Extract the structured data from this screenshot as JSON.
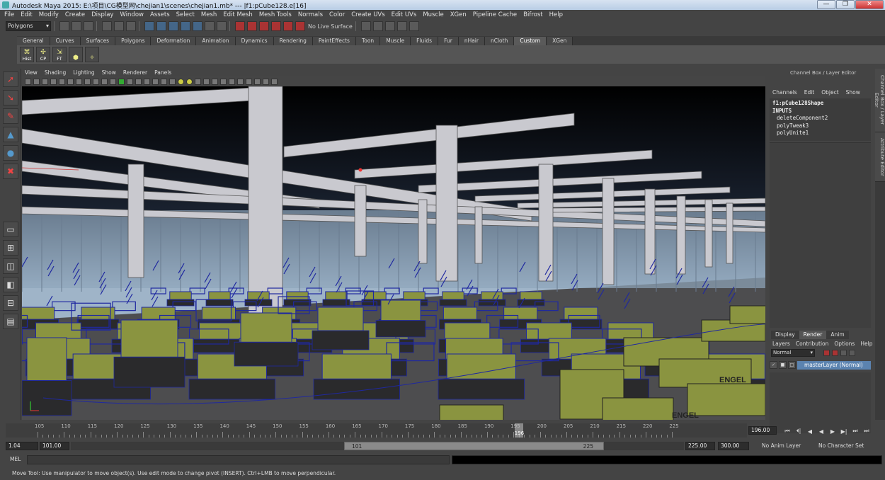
{
  "window": {
    "title": "Autodesk Maya 2015: E:\\项目\\CG模型网\\chejian1\\scenes\\chejian1.mb*   ---   |f1:pCube128.e[16]",
    "min": "—",
    "max": "❐",
    "close": "✕"
  },
  "menu": [
    "File",
    "Edit",
    "Modify",
    "Create",
    "Display",
    "Window",
    "Assets",
    "Select",
    "Mesh",
    "Edit Mesh",
    "Mesh Tools",
    "Normals",
    "Color",
    "Create UVs",
    "Edit UVs",
    "Muscle",
    "XGen",
    "Pipeline Cache",
    "Bifrost",
    "Help"
  ],
  "status_line": {
    "mode": "Polygons",
    "live_surface": "No Live Surface"
  },
  "shelf": {
    "tabs": [
      "General",
      "Curves",
      "Surfaces",
      "Polygons",
      "Deformation",
      "Animation",
      "Dynamics",
      "Rendering",
      "PaintEffects",
      "Toon",
      "Muscle",
      "Fluids",
      "Fur",
      "nHair",
      "nCloth",
      "Custom",
      "XGen"
    ],
    "active_tab": "Custom",
    "buttons": [
      {
        "label": "Hist",
        "icon": "history-icon"
      },
      {
        "label": "CP",
        "icon": "center-pivot-icon"
      },
      {
        "label": "FT",
        "icon": "freeze-transform-icon"
      },
      {
        "label": "",
        "icon": "custom-tool-icon"
      },
      {
        "label": "",
        "icon": "custom-tool-2-icon"
      }
    ]
  },
  "viewport": {
    "menu": [
      "View",
      "Shading",
      "Lighting",
      "Show",
      "Renderer",
      "Panels"
    ],
    "colors": {
      "sky_top": "#000000",
      "sky_horizon": "#9fb4c8",
      "floor": "#4d4d4f",
      "beam": "#c9c9cf",
      "machine": "#8a9440",
      "wire": "#1f28a0"
    },
    "labels": [
      "ENGEL",
      "ENGEL"
    ]
  },
  "channel_box": {
    "header": "Channel Box / Layer Editor",
    "menu": [
      "Channels",
      "Edit",
      "Object",
      "Show"
    ],
    "shape": "f1:pCube128Shape",
    "inputs_label": "INPUTS",
    "inputs": [
      "deleteComponent2",
      "polyTweak3",
      "polyUnite1"
    ]
  },
  "layer_editor": {
    "tabs": [
      "Display",
      "Render",
      "Anim"
    ],
    "active_tab": "Render",
    "menu": [
      "Layers",
      "Contribution",
      "Options",
      "Help"
    ],
    "blend_mode": "Normal",
    "layer_name": "masterLayer (Normal)"
  },
  "side_tabs": [
    "Channel Box / Layer Editor",
    "Attribute Editor"
  ],
  "timeline": {
    "ticks": [
      "105",
      "110",
      "115",
      "120",
      "125",
      "130",
      "135",
      "140",
      "145",
      "150",
      "155",
      "160",
      "165",
      "170",
      "175",
      "180",
      "185",
      "190",
      "195",
      "200",
      "205",
      "210",
      "215",
      "220",
      "225"
    ],
    "current_frame": "196",
    "current_frame_field": "196.00",
    "playback": [
      "⏮",
      "⏴|",
      "◀",
      "◀",
      "▶",
      "▶|",
      "⏭",
      "⏭"
    ]
  },
  "range": {
    "start": "1.04",
    "playback_start": "101.00",
    "handle_start": "101",
    "handle_end": "225",
    "playback_end": "225.00",
    "end": "300.00",
    "anim_layer": "No Anim Layer",
    "character_set": "No Character Set"
  },
  "command": {
    "label": "MEL"
  },
  "help_line": "Move Tool: Use manipulator to move object(s). Use edit mode to change pivot (INSERT).  Ctrl+LMB to move perpendicular."
}
